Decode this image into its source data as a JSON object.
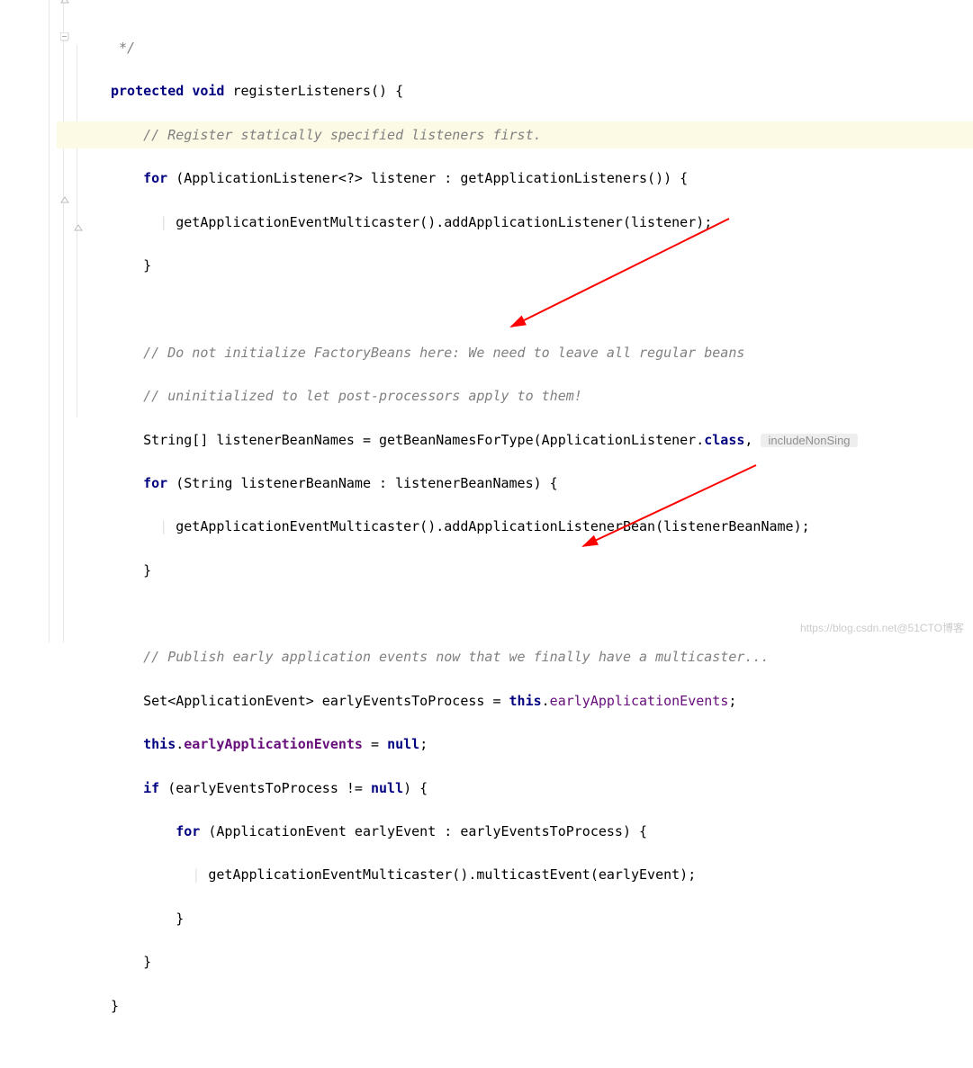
{
  "code": {
    "l0": " */",
    "l1_kw1": "protected",
    "l1_kw2": "void",
    "l1_rest": "registerListeners() {",
    "l2": "// Register statically specified listeners first.",
    "l3_kw": "for ",
    "l3_rest": "(ApplicationListener<?> listener : getApplicationListeners()) {",
    "l4": "getApplicationEventMulticaster().addApplicationListener(listener);",
    "l5": "}",
    "l7a": "// Do not initialize FactoryBeans here: We need to leave all regular beans",
    "l7b": "// uninitialized to let post-processors apply to them!",
    "l8a": "String[] listenerBeanNames = getBeanNamesForType(ApplicationListener.",
    "l8_kw": "class",
    "l8b": ", ",
    "l8_hint": "includeNonSing",
    "l9_kw": "for ",
    "l9_rest": "(String listenerBeanName : listenerBeanNames) {",
    "l10": "getApplicationEventMulticaster().addApplicationListenerBean(listenerBeanName);",
    "l11": "}",
    "l13": "// Publish early application events now that we finally have a multicaster...",
    "l14a": "Set<ApplicationEvent> earlyEventsToProcess = ",
    "l14_kw": "this",
    "l14b": ".",
    "l14_fld": "earlyApplicationEvents",
    "l14c": ";",
    "l15_kw1": "this",
    "l15a": ".",
    "l15_fld": "earlyApplicationEvents",
    "l15b": " = ",
    "l15_kw2": "null",
    "l15c": ";",
    "l16_kw1": "if ",
    "l16a": "(earlyEventsToProcess != ",
    "l16_kw2": "null",
    "l16b": ") {",
    "l17_kw": "for ",
    "l17_rest": "(ApplicationEvent earlyEvent : earlyEventsToProcess) {",
    "l18": "getApplicationEventMulticaster().multicastEvent(earlyEvent);",
    "l19": "}",
    "l20": "}",
    "l22": "}"
  },
  "watermark": "https://blog.csdn.net@51CTO博客"
}
